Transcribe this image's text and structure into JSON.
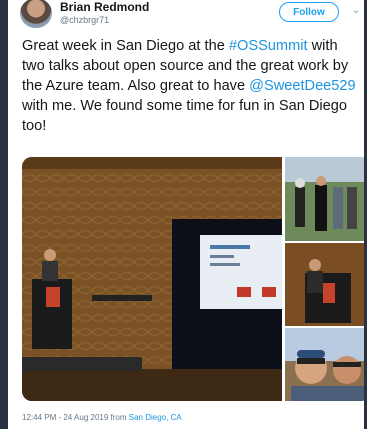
{
  "tweet": {
    "author_name": "Brian Redmond",
    "author_handle": "@chzbrgr71",
    "follow_label": "Follow",
    "text_1": "Great week in San Diego at the ",
    "hashtag": "#OSSummit",
    "text_2": " with two talks about open source and the great work by the Azure team. Also great to have ",
    "mention": "@SweetDee529",
    "text_3": " with me. We found some time for fun in San Diego too!",
    "timestamp": "12:44 PM - 24 Aug 2019 from ",
    "location": "San Diego, CA"
  },
  "icons": {
    "menu": "chevron-down-icon"
  },
  "colors": {
    "accent": "#1da1f2",
    "link": "#1b95e0",
    "text": "#14171a",
    "muted": "#657786"
  }
}
